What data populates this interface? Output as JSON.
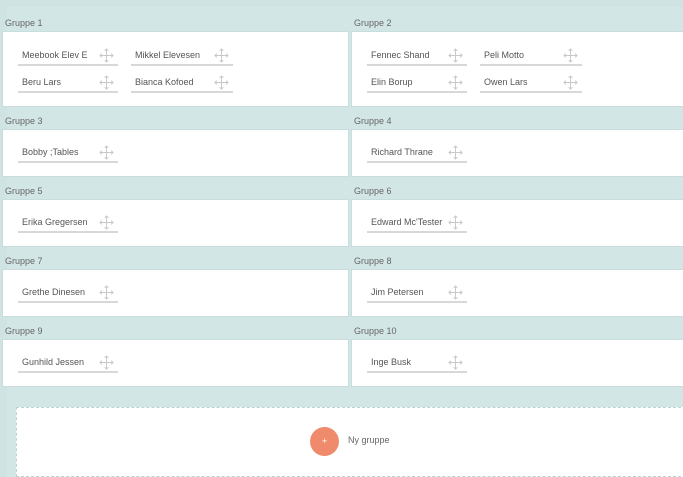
{
  "groups": [
    {
      "title": "Gruppe 1",
      "members": [
        "Meebook Elev E",
        "Mikkel Elevesen",
        "Beru Lars",
        "Bianca Kofoed"
      ]
    },
    {
      "title": "Gruppe 2",
      "members": [
        "Fennec Shand",
        "Peli Motto",
        "Elin Borup",
        "Owen Lars"
      ]
    },
    {
      "title": "Gruppe 3",
      "members": [
        "Bobby ;Tables"
      ]
    },
    {
      "title": "Gruppe 4",
      "members": [
        "Richard Thrane"
      ]
    },
    {
      "title": "Gruppe 5",
      "members": [
        "Erika Gregersen"
      ]
    },
    {
      "title": "Gruppe 6",
      "members": [
        "Edward Mc'Tester"
      ]
    },
    {
      "title": "Gruppe 7",
      "members": [
        "Grethe Dinesen"
      ]
    },
    {
      "title": "Gruppe 8",
      "members": [
        "Jim Petersen"
      ]
    },
    {
      "title": "Gruppe 9",
      "members": [
        "Gunhild Jessen"
      ]
    },
    {
      "title": "Gruppe 10",
      "members": [
        "Inge Busk"
      ]
    }
  ],
  "add_group": {
    "button_symbol": "+",
    "label": "Ny gruppe"
  },
  "icons": {
    "drag": "move-arrows-icon"
  },
  "colors": {
    "background": "#cfe3e3",
    "accent": "#f08a6c"
  }
}
